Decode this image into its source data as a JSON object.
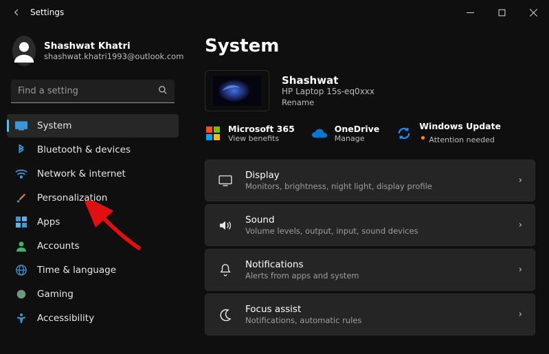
{
  "titlebar": {
    "title": "Settings"
  },
  "profile": {
    "name": "Shashwat Khatri",
    "email": "shashwat.khatri1993@outlook.com"
  },
  "search": {
    "placeholder": "Find a setting"
  },
  "sidebar": {
    "items": [
      {
        "label": "System"
      },
      {
        "label": "Bluetooth & devices"
      },
      {
        "label": "Network & internet"
      },
      {
        "label": "Personalization"
      },
      {
        "label": "Apps"
      },
      {
        "label": "Accounts"
      },
      {
        "label": "Time & language"
      },
      {
        "label": "Gaming"
      },
      {
        "label": "Accessibility"
      }
    ]
  },
  "page": {
    "title": "System",
    "device": {
      "name": "Shashwat",
      "model": "HP Laptop 15s-eq0xxx",
      "rename": "Rename"
    },
    "quick": [
      {
        "title": "Microsoft 365",
        "sub": "View benefits"
      },
      {
        "title": "OneDrive",
        "sub": "Manage"
      },
      {
        "title": "Windows Update",
        "sub": "Attention needed",
        "warn": "•"
      }
    ],
    "cards": [
      {
        "title": "Display",
        "sub": "Monitors, brightness, night light, display profile"
      },
      {
        "title": "Sound",
        "sub": "Volume levels, output, input, sound devices"
      },
      {
        "title": "Notifications",
        "sub": "Alerts from apps and system"
      },
      {
        "title": "Focus assist",
        "sub": "Notifications, automatic rules"
      }
    ]
  }
}
